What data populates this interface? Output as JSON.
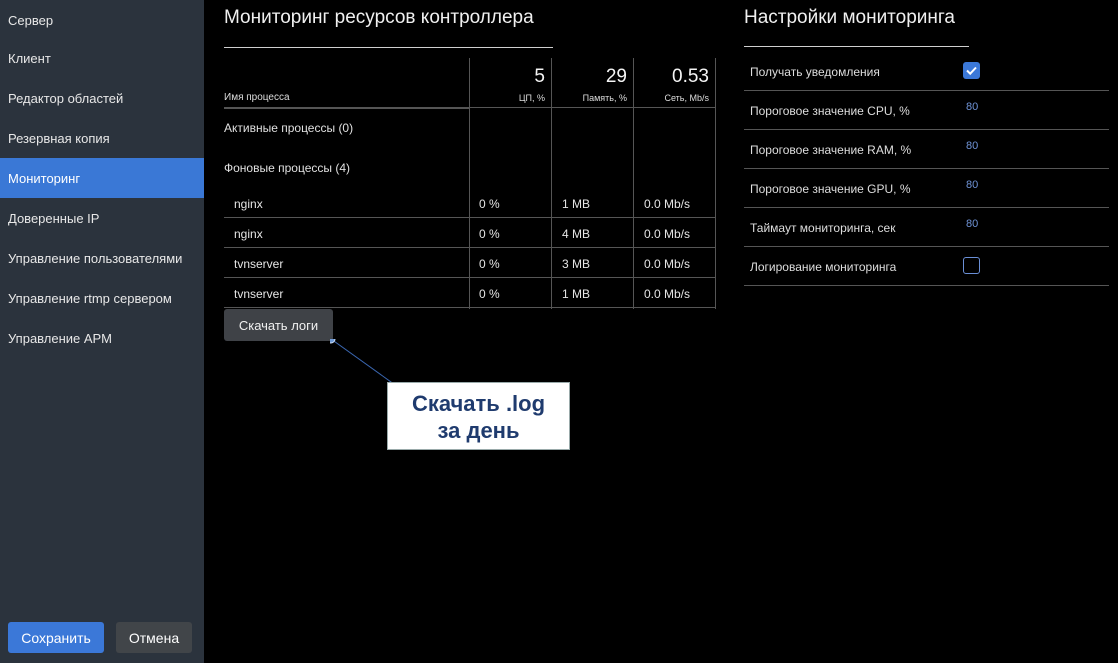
{
  "sidebar": {
    "items": [
      {
        "label": "Сервер"
      },
      {
        "label": "Клиент"
      },
      {
        "label": "Редактор областей"
      },
      {
        "label": "Резервная копия"
      },
      {
        "label": "Мониторинг"
      },
      {
        "label": "Доверенные IP"
      },
      {
        "label": "Управление пользователями"
      },
      {
        "label": "Управление rtmp сервером"
      },
      {
        "label": "Управление АРМ"
      }
    ],
    "save_label": "Сохранить",
    "cancel_label": "Отмена"
  },
  "monitoring": {
    "title": "Мониторинг ресурсов контроллера",
    "header": {
      "name_label": "Имя процесса",
      "cpu_value": "5",
      "cpu_unit": "ЦП, %",
      "mem_value": "29",
      "mem_unit": "Память, %",
      "net_value": "0.53",
      "net_unit": "Сеть, Mb/s"
    },
    "active_group": "Активные процессы (0)",
    "background_group": "Фоновые процессы (4)",
    "rows": [
      {
        "name": "nginx",
        "cpu": "0 %",
        "mem": "1 MB",
        "net": "0.0 Mb/s"
      },
      {
        "name": "nginx",
        "cpu": "0 %",
        "mem": "4 MB",
        "net": "0.0 Mb/s"
      },
      {
        "name": "tvnserver",
        "cpu": "0 %",
        "mem": "3 MB",
        "net": "0.0 Mb/s"
      },
      {
        "name": "tvnserver",
        "cpu": "0 %",
        "mem": "1 MB",
        "net": "0.0 Mb/s"
      }
    ],
    "download_logs_label": "Скачать логи"
  },
  "callout": {
    "line1": "Скачать .log",
    "line2": "за день"
  },
  "settings": {
    "title": "Настройки мониторинга",
    "rows": [
      {
        "label": "Получать уведомления",
        "checked": true
      },
      {
        "label": "Пороговое значение CPU, %",
        "value": "80"
      },
      {
        "label": "Пороговое значение RAM, %",
        "value": "80"
      },
      {
        "label": "Пороговое значение GPU, %",
        "value": "80"
      },
      {
        "label": "Таймаут мониторинга, сек",
        "value": "80"
      },
      {
        "label": "Логирование мониторинга",
        "checked": false
      }
    ]
  },
  "colors": {
    "accent": "#3b78d8",
    "sidebar_bg": "#2b333d",
    "callout_text": "#1f3b6e"
  }
}
